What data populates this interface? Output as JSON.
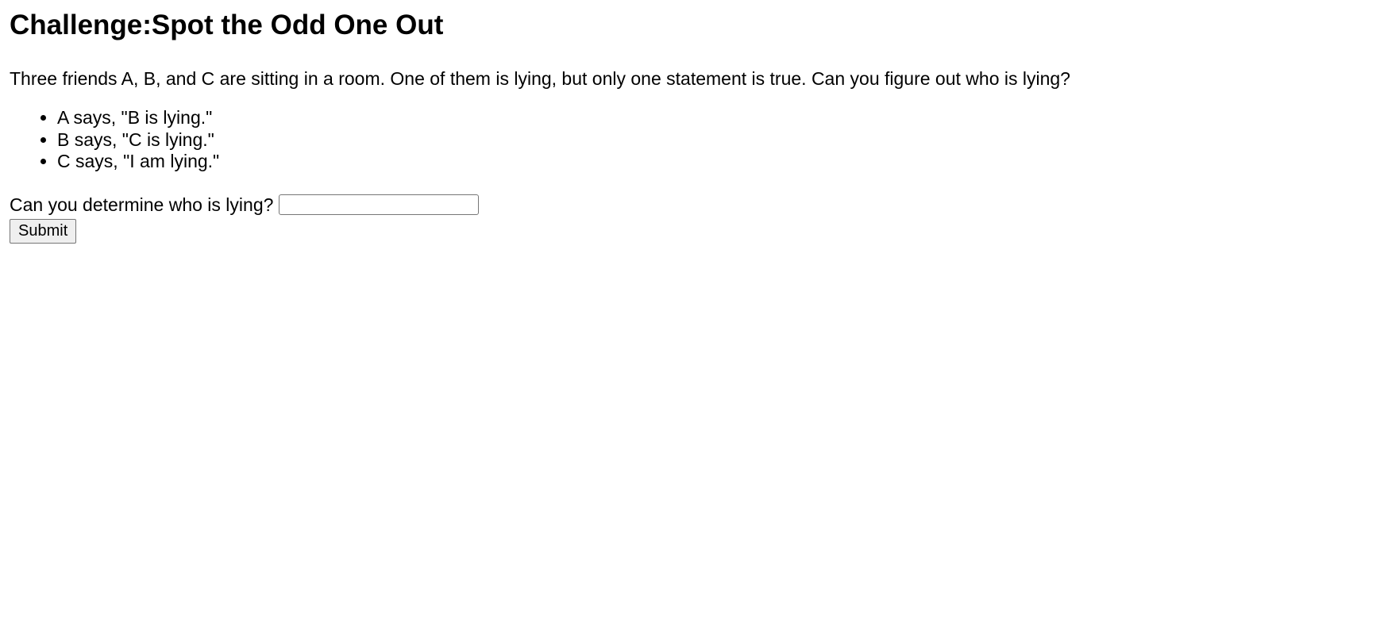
{
  "heading": "Challenge:Spot the Odd One Out",
  "intro": "Three friends A, B, and C are sitting in a room. One of them is lying, but only one statement is true. Can you figure out who is lying?",
  "statements": [
    "A says, \"B is lying.\"",
    "B says, \"C is lying.\"",
    "C says, \"I am lying.\""
  ],
  "question": {
    "label": "Can you determine who is lying?",
    "input_value": "",
    "placeholder": ""
  },
  "submit_label": "Submit"
}
